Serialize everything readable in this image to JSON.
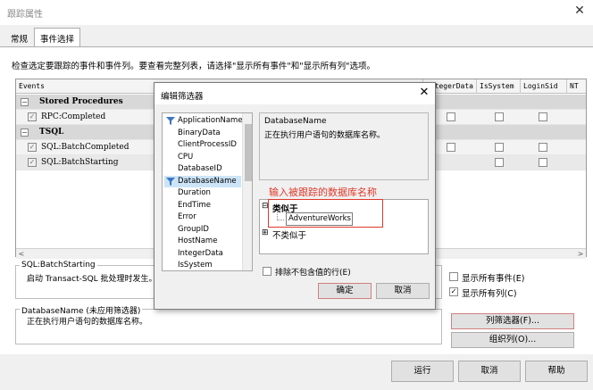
{
  "window": {
    "title": "跟踪属性",
    "close_glyph": "✕"
  },
  "tabs": [
    {
      "label": "常规"
    },
    {
      "label": "事件选择"
    }
  ],
  "instruction": "检查选定要跟踪的事件和事件列。要查看完整列表，请选择\"显示所有事件\"和\"显示所有列\"选项。",
  "grid": {
    "columns": [
      "Events",
      "IntegerData",
      "IsSystem",
      "LoginSid",
      "NT"
    ],
    "rows": [
      {
        "type": "category",
        "label": "Stored Procedures"
      },
      {
        "type": "event",
        "label": "RPC:Completed"
      },
      {
        "type": "category",
        "label": "TSQL"
      },
      {
        "type": "event",
        "label": "SQL:BatchCompleted"
      },
      {
        "type": "event",
        "label": "SQL:BatchStarting"
      }
    ],
    "checkmark": "✓",
    "expander_minus": "−",
    "scroll_left": "<",
    "scroll_right": ">"
  },
  "event_desc": {
    "title": "SQL:BatchStarting",
    "text": "启动 Transact-SQL 批处理时发生。"
  },
  "column_desc": {
    "title": "DatabaseName (未应用筛选器)",
    "text": "正在执行用户语句的数据库名称。"
  },
  "options": {
    "show_all_events": "显示所有事件(E)",
    "show_all_columns": "显示所有列(C)",
    "show_all_events_checked": false,
    "show_all_columns_checked": true
  },
  "side_buttons": {
    "column_filters": "列筛选器(F)...",
    "organize_columns": "组织列(O)..."
  },
  "footer_buttons": {
    "run": "运行",
    "cancel": "取消",
    "help": "帮助"
  },
  "filter_dialog": {
    "title": "编辑筛选器",
    "close_glyph": "✕",
    "fields": [
      {
        "name": "ApplicationName",
        "filtered": true
      },
      {
        "name": "BinaryData",
        "filtered": false
      },
      {
        "name": "ClientProcessID",
        "filtered": false
      },
      {
        "name": "CPU",
        "filtered": false
      },
      {
        "name": "DatabaseID",
        "filtered": false
      },
      {
        "name": "DatabaseName",
        "filtered": true,
        "selected": true
      },
      {
        "name": "Duration",
        "filtered": false
      },
      {
        "name": "EndTime",
        "filtered": false
      },
      {
        "name": "Error",
        "filtered": false
      },
      {
        "name": "GroupID",
        "filtered": false
      },
      {
        "name": "HostName",
        "filtered": false
      },
      {
        "name": "IntegerData",
        "filtered": false
      },
      {
        "name": "IsSystem",
        "filtered": false
      }
    ],
    "field_desc_title": "DatabaseName",
    "field_desc_text": "正在执行用户语句的数据库名称。",
    "annotation": "输入被跟踪的数据库名称",
    "tree": {
      "like_label": "类似于",
      "like_value": "AdventureWorks",
      "not_like_label": "不类似于",
      "expander_minus": "⊟",
      "expander_plus": "⊞"
    },
    "exclude_nulls_label": "排除不包含值的行(E)",
    "ok": "确定",
    "cancel": "取消"
  },
  "colors": {
    "accent_red": "#e0392b",
    "selection_blue": "#cce4f7",
    "row_gray": "#d8d8d8",
    "funnel_blue": "#3b78c4"
  }
}
